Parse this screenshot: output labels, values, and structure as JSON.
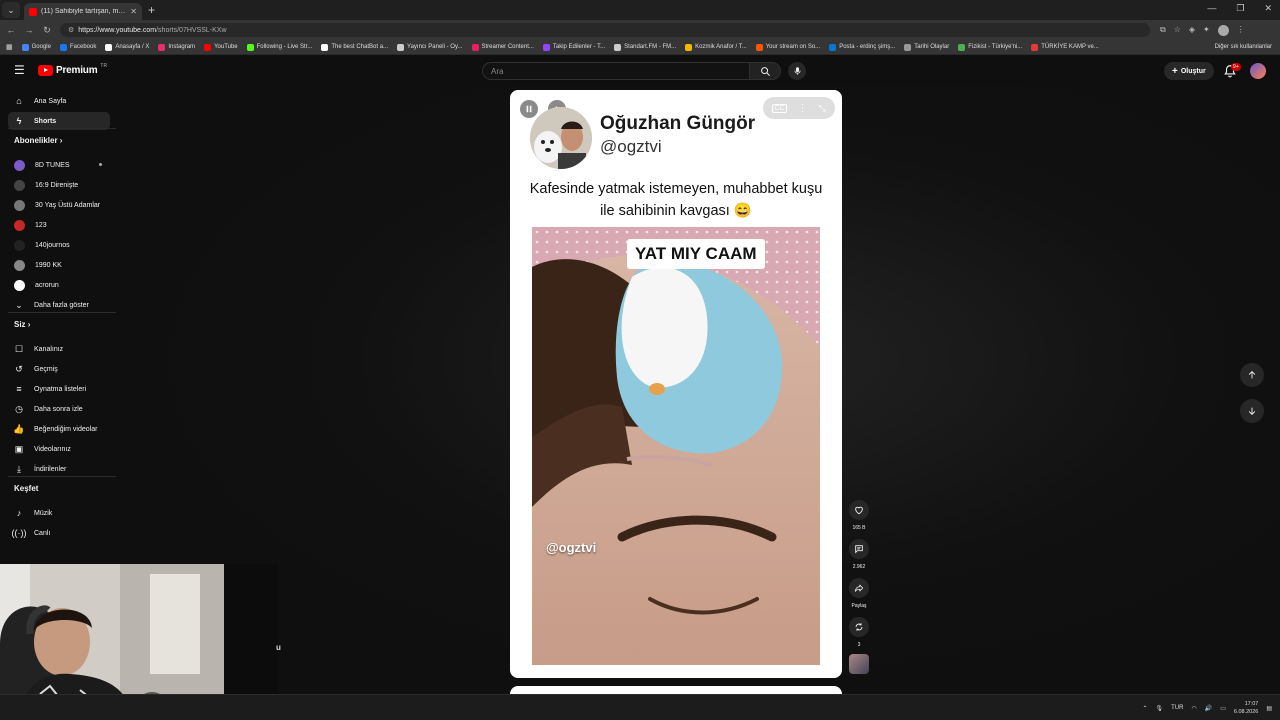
{
  "browser": {
    "tab_title": "(11) Sahibiyle tartışan, muhab...",
    "url_host": "https://www.youtube.com",
    "url_path": "/shorts/07HVSSL-KXw"
  },
  "bookmarks": [
    {
      "label": "Google",
      "color": "#4285f4"
    },
    {
      "label": "Facebook",
      "color": "#1877f2"
    },
    {
      "label": "Anasayfa / X",
      "color": "#ffffff"
    },
    {
      "label": "Instagram",
      "color": "#e1306c"
    },
    {
      "label": "YouTube",
      "color": "#ff0000"
    },
    {
      "label": "Following - Live Str...",
      "color": "#53fc18"
    },
    {
      "label": "The best ChatBot a...",
      "color": "#ffffff"
    },
    {
      "label": "Yayıncı Paneli - Oy...",
      "color": "#cccccc"
    },
    {
      "label": "Streamer Content...",
      "color": "#e91e63"
    },
    {
      "label": "Takip Edilenler - T...",
      "color": "#9146ff"
    },
    {
      "label": "Standart.FM - FM...",
      "color": "#cccccc"
    },
    {
      "label": "Kozmik Anafor / T...",
      "color": "#f5b700"
    },
    {
      "label": "Your stream on So...",
      "color": "#ff5500"
    },
    {
      "label": "Posta - erdinç şimş...",
      "color": "#0078d4"
    },
    {
      "label": "Tarihi Olaylar",
      "color": "#999999"
    },
    {
      "label": "Fizikist - Türkiye'ni...",
      "color": "#4caf50"
    },
    {
      "label": "TÜRKİYE KAMP ve...",
      "color": "#e53935"
    }
  ],
  "bookmarks_other": "Diğer sık kullanılanlar",
  "header": {
    "brand": "Premium",
    "country": "TR",
    "search_placeholder": "Ara",
    "create_label": "Oluştur",
    "notif_count": "9+"
  },
  "sidebar": {
    "main": [
      {
        "label": "Ana Sayfa",
        "icon": "home-icon"
      },
      {
        "label": "Shorts",
        "icon": "shorts-icon"
      }
    ],
    "subs_heading": "Abonelikler",
    "subs": [
      {
        "label": "8D TUNES",
        "color": "#7a5cc4"
      },
      {
        "label": "16:9 Direnişte",
        "color": "#444444"
      },
      {
        "label": "30 Yaş Üstü Adamlar",
        "color": "#777777"
      },
      {
        "label": "123",
        "color": "#c62828"
      },
      {
        "label": "140journos",
        "color": "#222222"
      },
      {
        "label": "1990 KK",
        "color": "#888888"
      },
      {
        "label": "acrorun",
        "color": "#ffffff"
      }
    ],
    "show_more": "Daha fazla göster",
    "you_heading": "Siz",
    "you": [
      {
        "label": "Kanalınız",
        "icon": "channel-icon"
      },
      {
        "label": "Geçmiş",
        "icon": "history-icon"
      },
      {
        "label": "Oynatma listeleri",
        "icon": "playlist-icon"
      },
      {
        "label": "Daha sonra izle",
        "icon": "watch-later-icon"
      },
      {
        "label": "Beğendiğim videolar",
        "icon": "like-icon"
      },
      {
        "label": "Videolarınız",
        "icon": "your-videos-icon"
      },
      {
        "label": "İndirilenler",
        "icon": "download-icon"
      }
    ],
    "explore_heading": "Keşfet",
    "explore": [
      {
        "label": "Müzik",
        "icon": "music-icon"
      },
      {
        "label": "Canlı",
        "icon": "live-icon"
      }
    ]
  },
  "short": {
    "creator_name": "Oğuzhan Güngör",
    "creator_handle": "@ogztvi",
    "caption": "Kafesinde yatmak istemeyen, muhabbet kuşu ile sahibinin kavgası 😄",
    "overlay_text": "YAT MIY CAAM",
    "watermark": "@ogztvi"
  },
  "actions": {
    "likes": "165 B",
    "comments": "2.962",
    "share": "Paylaş",
    "remix": "3"
  },
  "webcam_fragment": "u",
  "tray": {
    "lang": "TUR",
    "time": "17:07",
    "date": "6.08.2026"
  }
}
